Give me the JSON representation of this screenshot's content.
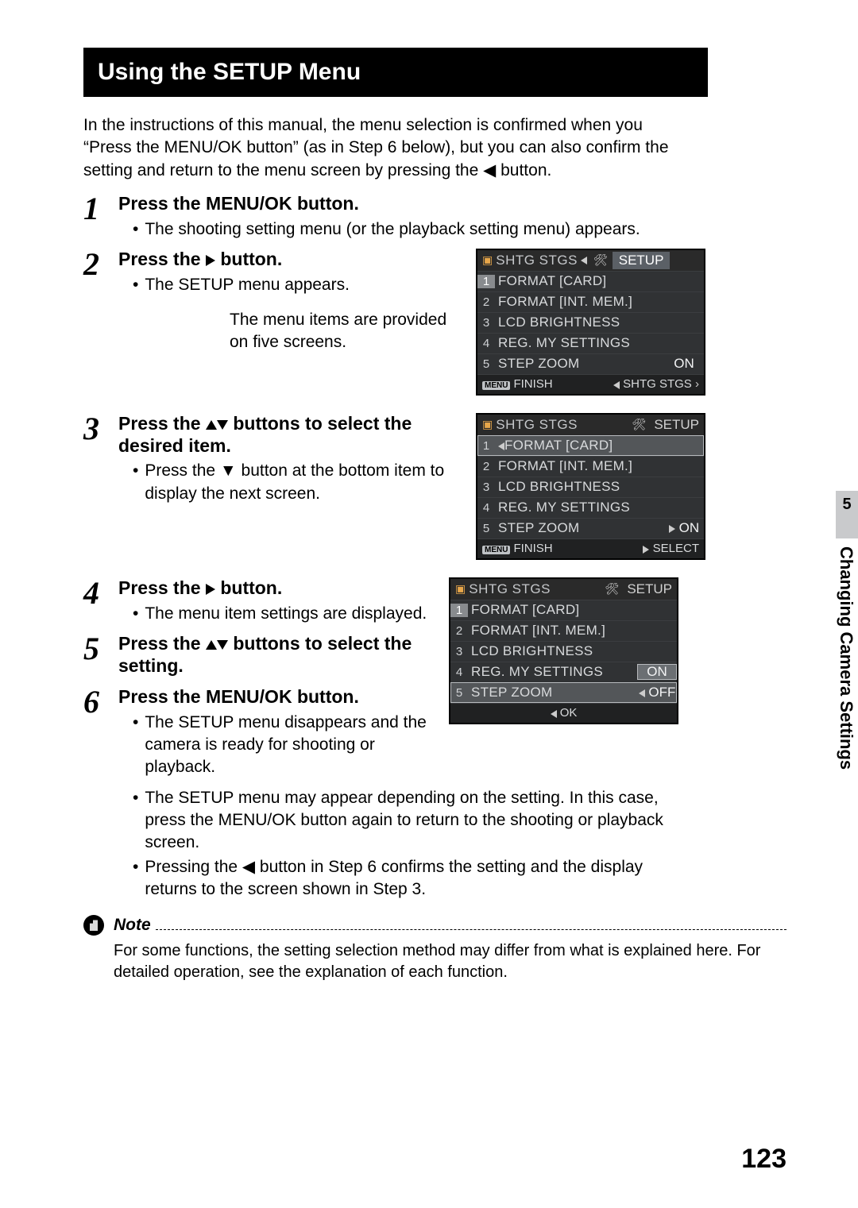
{
  "title": "Using the SETUP Menu",
  "intro": "In the instructions of this manual, the menu selection is confirmed when you “Press the MENU/OK button” (as in Step 6 below), but you can also confirm the setting and return to the menu screen by pressing the ◀ button.",
  "steps": {
    "s1": {
      "num": "1",
      "title_a": "Press the MENU/OK button.",
      "b1": "The shooting setting menu (or the playback setting menu) appears."
    },
    "s2": {
      "num": "2",
      "title_a": "Press the ",
      "title_b": " button.",
      "b1": "The SETUP menu appears.",
      "caption": "The menu items are provided on five screens."
    },
    "s3": {
      "num": "3",
      "title_a": "Press the ",
      "title_b": " buttons to select the desired item.",
      "b1": "Press the ▼ button at the bottom item to display the next screen."
    },
    "s4": {
      "num": "4",
      "title_a": "Press the ",
      "title_b": " button.",
      "b1": "The menu item settings are displayed."
    },
    "s5": {
      "num": "5",
      "title_a": "Press the ",
      "title_b": " buttons to select the setting."
    },
    "s6": {
      "num": "6",
      "title_a": "Press the MENU/OK button.",
      "b1": "The SETUP menu disappears and the camera is ready for shooting or playback.",
      "b2": "The SETUP menu may appear depending on the setting. In this case, press the MENU/OK button again to return to the shooting or playback screen.",
      "b3": "Pressing the ◀ button in Step 6 confirms the setting and the display returns to the screen shown in Step 3."
    }
  },
  "lcd_common": {
    "tab1": "SHTG STGS",
    "tab2": "SETUP",
    "rows": [
      {
        "n": "1",
        "label": "FORMAT [CARD]"
      },
      {
        "n": "2",
        "label": "FORMAT [INT. MEM.]"
      },
      {
        "n": "3",
        "label": "LCD BRIGHTNESS"
      },
      {
        "n": "4",
        "label": "REG. MY SETTINGS"
      },
      {
        "n": "5",
        "label": "STEP ZOOM"
      }
    ],
    "on": "ON",
    "off": "OFF",
    "finish": "FINISH",
    "nav1": "SHTG STGS",
    "select": "SELECT",
    "ok": "OK"
  },
  "note": {
    "label": "Note",
    "body": "For some functions, the setting selection method may differ from what is explained here. For detailed operation, see the explanation of each function."
  },
  "side": {
    "chapter": "5",
    "title": "Changing Camera Settings"
  },
  "page_num": "123"
}
